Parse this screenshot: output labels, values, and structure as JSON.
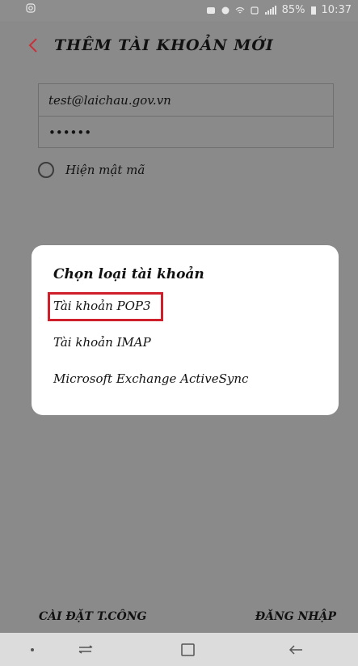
{
  "status_bar": {
    "battery_percent": "85%",
    "time": "10:37"
  },
  "app_bar": {
    "title": "THÊM TÀI KHOẢN MỚI"
  },
  "form": {
    "email_value": "test@laichau.gov.vn",
    "password_value": "••••••",
    "show_password_label": "Hiện mật mã"
  },
  "dialog": {
    "title": "Chọn loại tài khoản",
    "options": [
      {
        "label": "Tài khoản POP3"
      },
      {
        "label": "Tài khoản IMAP"
      },
      {
        "label": "Microsoft Exchange ActiveSync"
      }
    ]
  },
  "bottom_actions": {
    "manual_setup_label": "CÀI ĐẶT T.CÔNG",
    "login_label": "ĐĂNG NHẬP"
  },
  "colors": {
    "background": "#8a8a8a",
    "dialog": "#ffffff",
    "accent": "#cf1f2a",
    "navbar": "#dcdcdc"
  }
}
